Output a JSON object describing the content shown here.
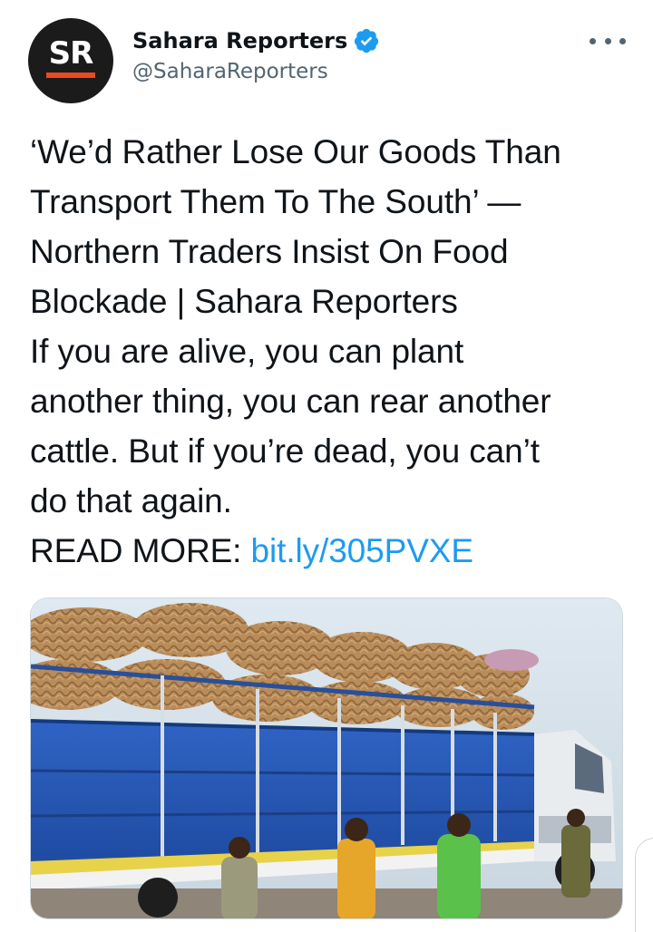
{
  "author": {
    "display_name": "Sahara Reporters",
    "handle": "@SaharaReporters",
    "avatar_text": "SR",
    "verified": true,
    "verified_icon": "verified-badge-icon"
  },
  "menu": {
    "icon": "more-horizontal-icon"
  },
  "tweet": {
    "lines": [
      "‘We’d Rather Lose Our Goods Than",
      "Transport Them To The South’ —",
      "Northern Traders Insist On Food",
      "Blockade | Sahara Reporters",
      "If you are alive, you can plant",
      "another thing, you can rear another",
      "cattle. But if you’re dead, you can’t",
      "do that again."
    ],
    "read_more_label": "READ MORE: ",
    "link_text": "bit.ly/305PVXE"
  },
  "media": {
    "kind": "photo",
    "subject": "truck-loaded-with-produce-photo"
  },
  "colors": {
    "link": "#1d9bf0",
    "verified": "#1d9bf0",
    "secondary_text": "#536471",
    "avatar_bg": "#1b1b1b",
    "avatar_accent": "#ea4b1f"
  }
}
